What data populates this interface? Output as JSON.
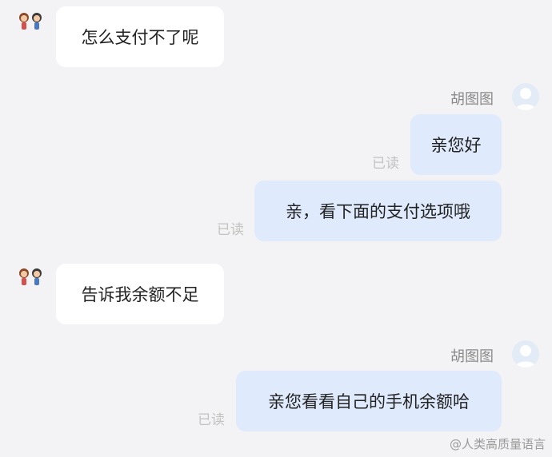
{
  "messages": [
    {
      "side": "left",
      "text": "怎么支付不了呢"
    },
    {
      "side": "right",
      "sender": "胡图图",
      "text": "亲您好",
      "status": "已读"
    },
    {
      "side": "right",
      "text": "亲，看下面的支付选项哦",
      "status": "已读"
    },
    {
      "side": "left",
      "text": "告诉我余额不足"
    },
    {
      "side": "right",
      "sender": "胡图图",
      "text": "亲您看看自己的手机余额哈",
      "status": "已读"
    }
  ],
  "watermark": "@人类高质量语言",
  "icons": {
    "left_avatar": "couple-avatar-icon",
    "right_avatar": "default-user-avatar-icon"
  },
  "colors": {
    "background": "#f3f3f5",
    "left_bubble": "#ffffff",
    "right_bubble": "#dfeafc",
    "read_status": "#c2c2c2"
  }
}
